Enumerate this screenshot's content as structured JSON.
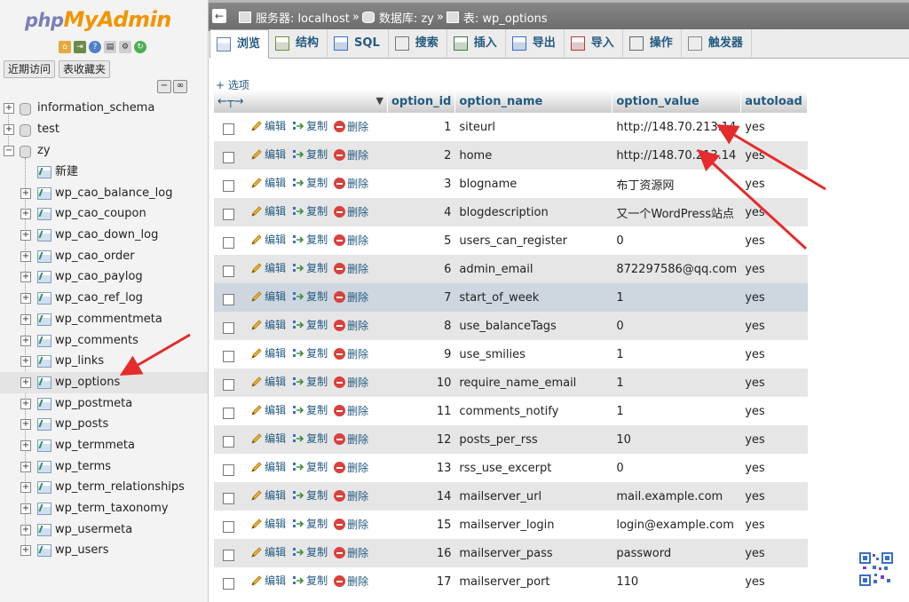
{
  "logo": {
    "php": "php",
    "myadmin": "MyAdmin"
  },
  "nav": {
    "tabs": [
      "近期访问",
      "表收藏夹"
    ],
    "databases": [
      "information_schema",
      "test",
      "zy"
    ],
    "new_label": "新建",
    "tables": [
      "wp_cao_balance_log",
      "wp_cao_coupon",
      "wp_cao_down_log",
      "wp_cao_order",
      "wp_cao_paylog",
      "wp_cao_ref_log",
      "wp_commentmeta",
      "wp_comments",
      "wp_links",
      "wp_options",
      "wp_postmeta",
      "wp_posts",
      "wp_termmeta",
      "wp_terms",
      "wp_term_relationships",
      "wp_term_taxonomy",
      "wp_usermeta",
      "wp_users"
    ],
    "active_table": "wp_options"
  },
  "breadcrumb": {
    "server": "服务器: localhost",
    "sep": "»",
    "database": "数据库: zy",
    "table": "表: wp_options"
  },
  "tabs": [
    {
      "label": "浏览",
      "icon": "browse-icon"
    },
    {
      "label": "结构",
      "icon": "structure-icon"
    },
    {
      "label": "SQL",
      "icon": "sql-icon"
    },
    {
      "label": "搜索",
      "icon": "search-icon"
    },
    {
      "label": "插入",
      "icon": "insert-icon"
    },
    {
      "label": "导出",
      "icon": "export-icon"
    },
    {
      "label": "导入",
      "icon": "import-icon"
    },
    {
      "label": "操作",
      "icon": "wrench-icon"
    },
    {
      "label": "触发器",
      "icon": "trigger-icon"
    }
  ],
  "options_link": "+ 选项",
  "grid": {
    "nav_arrows": "←┬→",
    "columns": [
      "option_id",
      "option_name",
      "option_value",
      "autoload"
    ],
    "actions": {
      "edit": "编辑",
      "copy": "复制",
      "delete": "删除"
    },
    "rows": [
      [
        "1",
        "siteurl",
        "http://148.70.213.14",
        "yes"
      ],
      [
        "2",
        "home",
        "http://148.70.213.14",
        "yes"
      ],
      [
        "3",
        "blogname",
        "布丁资源网",
        "yes"
      ],
      [
        "4",
        "blogdescription",
        "又一个WordPress站点",
        "yes"
      ],
      [
        "5",
        "users_can_register",
        "0",
        "yes"
      ],
      [
        "6",
        "admin_email",
        "872297586@qq.com",
        "yes"
      ],
      [
        "7",
        "start_of_week",
        "1",
        "yes"
      ],
      [
        "8",
        "use_balanceTags",
        "0",
        "yes"
      ],
      [
        "9",
        "use_smilies",
        "1",
        "yes"
      ],
      [
        "10",
        "require_name_email",
        "1",
        "yes"
      ],
      [
        "11",
        "comments_notify",
        "1",
        "yes"
      ],
      [
        "12",
        "posts_per_rss",
        "10",
        "yes"
      ],
      [
        "13",
        "rss_use_excerpt",
        "0",
        "yes"
      ],
      [
        "14",
        "mailserver_url",
        "mail.example.com",
        "yes"
      ],
      [
        "15",
        "mailserver_login",
        "login@example.com",
        "yes"
      ],
      [
        "16",
        "mailserver_pass",
        "password",
        "yes"
      ],
      [
        "17",
        "mailserver_port",
        "110",
        "yes"
      ]
    ],
    "hover_row": 7
  },
  "colors": {
    "link": "#235a81",
    "accent_orange": "#f29400",
    "logo_purple": "#7b7fb5",
    "annotation_red": "#e52b2b"
  }
}
